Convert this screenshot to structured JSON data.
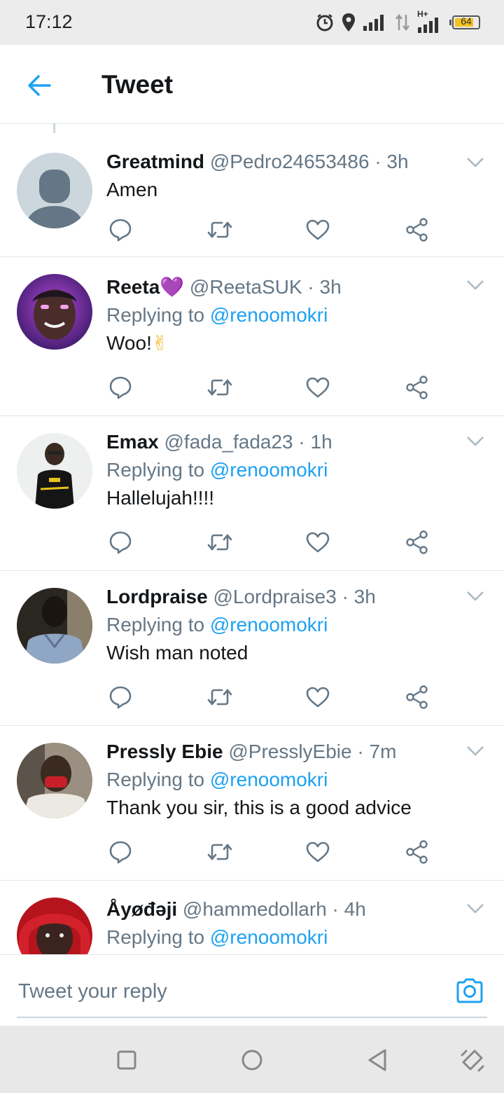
{
  "status_bar": {
    "time": "17:12",
    "battery": "64",
    "network_label": "H+"
  },
  "header": {
    "title": "Tweet"
  },
  "reply_prefix": "Replying to ",
  "tweets": [
    {
      "name": "Greatmind",
      "handle": "@Pedro24653486",
      "time": "· 3h",
      "reply_to": null,
      "text": "Amen",
      "emoji": ""
    },
    {
      "name": "Reeta",
      "name_emoji": "💜",
      "handle": "@ReetaSUK",
      "time": "· 3h",
      "reply_to": "@renoomokri",
      "text": "Woo!",
      "emoji": "✌"
    },
    {
      "name": "Emax",
      "handle": "@fada_fada23",
      "time": "· 1h",
      "reply_to": "@renoomokri",
      "text": "Hallelujah!!!!"
    },
    {
      "name": "Lordpraise",
      "handle": "@Lordpraise3",
      "time": "· 3h",
      "reply_to": "@renoomokri",
      "text": "Wish man noted"
    },
    {
      "name": "Pressly Ebie",
      "handle": "@PresslyEbie",
      "time": "· 7m",
      "reply_to": "@renoomokri",
      "text": "Thank you sir, this is a good advice"
    },
    {
      "name": "Åyøđəji",
      "handle": "@hammedollarh",
      "time": "· 4h",
      "reply_to": "@renoomokri",
      "text": ""
    }
  ],
  "composer": {
    "placeholder": "Tweet your reply"
  },
  "colors": {
    "accent": "#1da1f2",
    "secondary_text": "#657786",
    "divider": "#e1e8ed"
  },
  "icons": [
    "back-arrow-icon",
    "chevron-down-icon",
    "reply-icon",
    "retweet-icon",
    "like-icon",
    "share-icon",
    "camera-icon"
  ]
}
